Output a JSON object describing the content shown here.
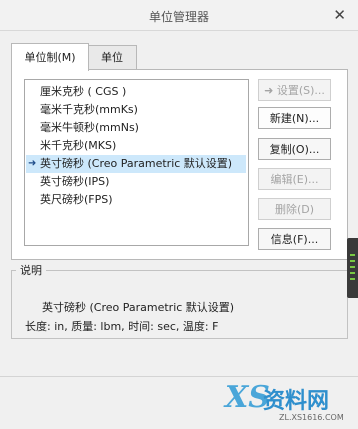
{
  "window": {
    "title": "单位管理器",
    "close_glyph": "✕"
  },
  "tabs": [
    {
      "label": "单位制(M)",
      "active": true
    },
    {
      "label": "单位",
      "active": false
    }
  ],
  "unit_systems": {
    "items": [
      {
        "label": "厘米克秒 ( CGS )"
      },
      {
        "label": "毫米千克秒(mmKs)"
      },
      {
        "label": "毫米牛顿秒(mmNs)"
      },
      {
        "label": "米千克秒(MKS)"
      },
      {
        "label": "英寸磅秒 (Creo Parametric 默认设置)",
        "selected": true,
        "marker": "➜"
      },
      {
        "label": "英寸磅秒(IPS)"
      },
      {
        "label": "英尺磅秒(FPS)"
      }
    ]
  },
  "buttons": {
    "set": {
      "icon": "➜",
      "label": "设置(S)...",
      "enabled": false
    },
    "new": {
      "label": "新建(N)...",
      "enabled": true
    },
    "copy": {
      "label": "复制(O)...",
      "enabled": true
    },
    "edit": {
      "label": "编辑(E)...",
      "enabled": false
    },
    "delete": {
      "label": "删除(D)",
      "enabled": false
    },
    "info": {
      "label": "信息(F)...",
      "enabled": true
    }
  },
  "description": {
    "label": "说明",
    "line1": "英寸磅秒 (Creo Parametric 默认设置)",
    "line2": "长度: in, 质量: lbm, 时间: sec, 温度: F"
  },
  "watermark": {
    "logo": "XS",
    "text": "资料网",
    "url": "ZL.XS1616.COM"
  },
  "colors": {
    "selection": "#cde8fb",
    "watermark": "#2f8fcd"
  }
}
